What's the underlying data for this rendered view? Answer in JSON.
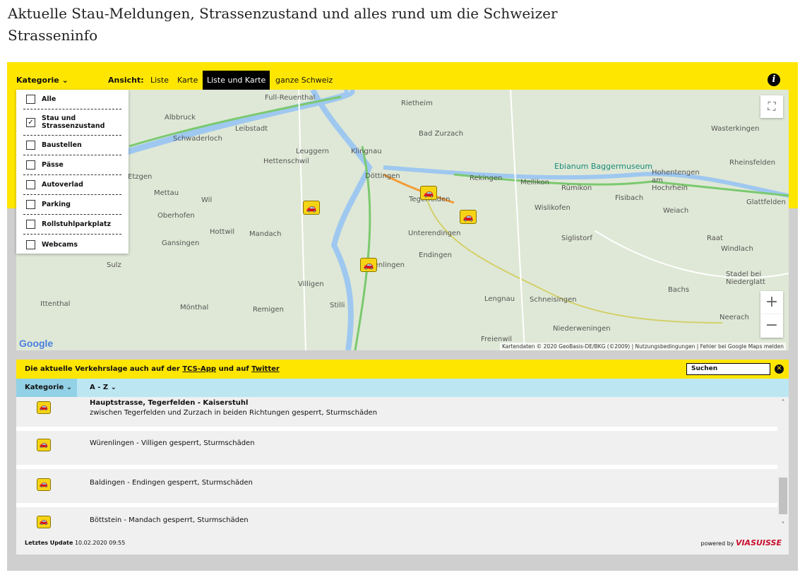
{
  "page_title": "Aktuelle Stau-Meldungen, Strassenzustand und alles rund um die Schweizer Strasseninfo",
  "toolbar": {
    "kategorie": "Kategorie",
    "ansicht": "Ansicht:",
    "views": [
      "Liste",
      "Karte",
      "Liste und Karte",
      "ganze Schweiz"
    ],
    "active_view": "Liste und Karte",
    "info": "i"
  },
  "categories": [
    {
      "label": "Alle",
      "checked": false
    },
    {
      "label": "Stau und Strassenzustand",
      "checked": true
    },
    {
      "label": "Baustellen",
      "checked": false
    },
    {
      "label": "Pässe",
      "checked": false
    },
    {
      "label": "Autoverlad",
      "checked": false
    },
    {
      "label": "Parking",
      "checked": false
    },
    {
      "label": "Rollstuhlparkplatz",
      "checked": false
    },
    {
      "label": "Webcams",
      "checked": false
    }
  ],
  "map": {
    "places": [
      "Full-Reuenthal",
      "Albbruck",
      "Leibstadt",
      "Schwaderloch",
      "Leuggern",
      "Klingnau",
      "Hettenschwil",
      "Etzgen",
      "Mettau",
      "Wil",
      "Oberhofen",
      "Döttingen",
      "Tegerfelden",
      "Rietheim",
      "Bad Zurzach",
      "Rekingen",
      "Mellikon",
      "Rümikon",
      "Wislikofen",
      "Ebianum Baggermuseum",
      "Hohentengen am Hochrhein",
      "Rheinsfelden",
      "Waster­kingen",
      "Fisibach",
      "Weiach",
      "Glattfelden",
      "Mandach",
      "Hottwil",
      "Gansingen",
      "Unterendingen",
      "Endingen",
      "Siglistorf",
      "Raat",
      "Windlach",
      "Sulz",
      "Villigen",
      "Würenlingen",
      "Stadel bei Niederglatt",
      "Bachs",
      "Ittenthal",
      "Mönthal",
      "Remigen",
      "Stilli",
      "Lengnau",
      "Schneisingen",
      "Niederweningen",
      "Neerach",
      "Freienwil"
    ],
    "zoom_in": "+",
    "zoom_out": "−",
    "attribution": "Kartendaten © 2020 GeoBasis-DE/BKG (©2009)",
    "terms": "Nutzungsbedingungen",
    "report": "Fehler bei Google Maps melden",
    "logo": "Google"
  },
  "infobar": {
    "text": "Die aktuelle Verkehrslage auch auf der",
    "link1": "TCS-App",
    "mid": "und auf",
    "link2": "Twitter",
    "search_placeholder": "Suchen"
  },
  "list_header": {
    "kategorie": "Kategorie",
    "az": "A - Z"
  },
  "items": [
    {
      "title": "Hauptstrasse, Tegerfelden - Kaiserstuhl",
      "desc": "zwischen Tegerfelden und Zurzach in beiden Richtungen gesperrt, Sturmschäden"
    },
    {
      "title": "",
      "desc": "Würenlingen - Villigen gesperrt, Sturmschäden"
    },
    {
      "title": "",
      "desc": "Baldingen - Endingen gesperrt, Sturmschäden"
    },
    {
      "title": "",
      "desc": "Böttstein - Mandach gesperrt, Sturmschäden"
    }
  ],
  "footer": {
    "label": "Letztes Update",
    "value": "10.02.2020 09:55",
    "powered": "powered by",
    "brand": "VIASUISSE"
  },
  "colors": {
    "yellow": "#ffe600",
    "blue": "#bde6f3",
    "dark": "#000000"
  }
}
